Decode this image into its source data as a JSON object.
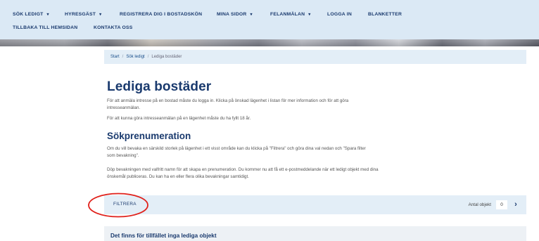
{
  "nav": {
    "row1": [
      {
        "label": "SÖK LEDIGT",
        "dropdown": true
      },
      {
        "label": "HYRESGÄST",
        "dropdown": true
      },
      {
        "label": "REGISTRERA DIG I BOSTADSKÖN",
        "dropdown": false
      },
      {
        "label": "MINA SIDOR",
        "dropdown": true
      },
      {
        "label": "FELANMÄLAN",
        "dropdown": true
      },
      {
        "label": "LOGGA IN",
        "dropdown": false
      },
      {
        "label": "BLANKETTER",
        "dropdown": false
      }
    ],
    "row2": [
      {
        "label": "TILLBAKA TILL HEMSIDAN"
      },
      {
        "label": "KONTAKTA OSS"
      }
    ],
    "caret": "▾"
  },
  "breadcrumb": {
    "items": [
      "Start",
      "Sök ledigt"
    ],
    "current": "Lediga bostäder",
    "separator": "/"
  },
  "main": {
    "title": "Lediga bostäder",
    "intro1": "För att anmäla intresse på en bostad måste du logga in. Klicka på önskad lägenhet i listan för mer information och för att göra intresseanmälan.",
    "intro2": "För att kunna göra intresseanmälan på en lägenhet måste du ha fyllt 18 år.",
    "subtitle": "Sökprenumeration",
    "sub1": "Om du vill bevaka en särskild storlek på lägenhet i ett visst område kan du klicka på \"Filtrera\" och göra dina val nedan och \"Spara filter som bevakning\".",
    "sub2": "Döp bevakningen med valfritt namn för att skapa en prenumeration. Du kommer nu att få ett e-postmeddelande när ett ledigt objekt med dina önskemål publiceras. Du kan ha en eller flera olika bevakningar samtidigt."
  },
  "filter": {
    "button_label": "FILTRERA",
    "count_label": "Antal objekt",
    "count_value": "0",
    "next_icon": "›"
  },
  "results": {
    "empty_message": "Det finns för tillfället inga lediga objekt"
  },
  "colors": {
    "nav_bg": "#dbe9f5",
    "brand_blue": "#1a3a6e",
    "bar_bg": "#e3eef7",
    "annotation_red": "#e0201a"
  }
}
